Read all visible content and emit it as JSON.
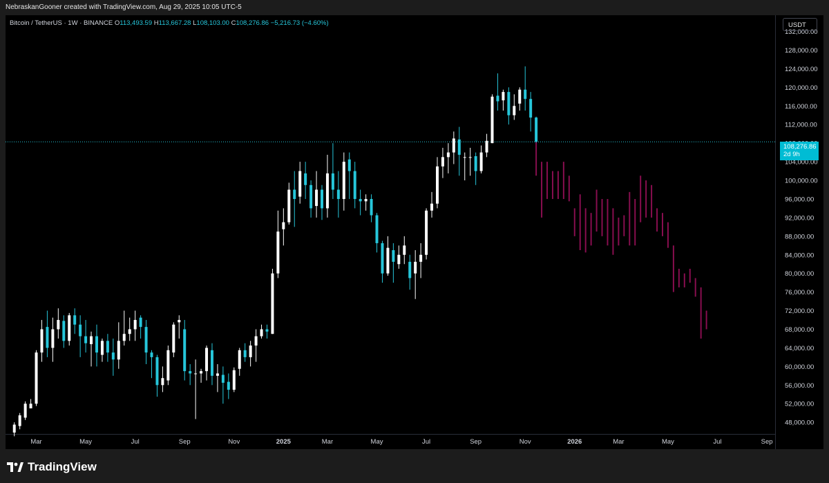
{
  "header": {
    "attribution": "NebraskanGooner created with TradingView.com, Aug 29, 2025 10:05 UTC-5"
  },
  "legend": {
    "symbol": "Bitcoin / TetherUS · 1W · BINANCE",
    "o_label": "O",
    "o": "113,493.59",
    "h_label": "H",
    "h": "113,667.28",
    "l_label": "L",
    "l": "108,103.00",
    "c_label": "C",
    "c": "108,276.86",
    "change": "−5,216.73 (−4.60%)"
  },
  "price_scale": {
    "currency": "USDT",
    "last_price": "108,276.86",
    "countdown": "2d 9h"
  },
  "footer": {
    "brand": "TradingView"
  },
  "colors": {
    "up": "#ffffff",
    "down": "#26c6da",
    "projection": "#880e4f",
    "background": "#000000"
  },
  "chart_data": {
    "type": "candlestick",
    "title": "Bitcoin / TetherUS · 1W · BINANCE",
    "y_ticks": [
      48000,
      52000,
      56000,
      60000,
      64000,
      68000,
      72000,
      76000,
      80000,
      84000,
      88000,
      92000,
      96000,
      100000,
      104000,
      108000,
      112000,
      116000,
      120000,
      124000,
      128000,
      132000
    ],
    "y_tick_labels": [
      "48,000.00",
      "52,000.00",
      "56,000.00",
      "60,000.00",
      "64,000.00",
      "68,000.00",
      "72,000.00",
      "76,000.00",
      "80,000.00",
      "84,000.00",
      "88,000.00",
      "92,000.00",
      "96,000.00",
      "100,000.00",
      "104,000.00",
      "108,000.00",
      "112,000.00",
      "116,000.00",
      "120,000.00",
      "124,000.00",
      "128,000.00",
      "132,000.00"
    ],
    "ylim": [
      45500,
      135500
    ],
    "x_ticks": [
      {
        "label": "Mar",
        "week": 4,
        "bold": false
      },
      {
        "label": "May",
        "week": 13,
        "bold": false
      },
      {
        "label": "Jul",
        "week": 22,
        "bold": false
      },
      {
        "label": "Sep",
        "week": 31,
        "bold": false
      },
      {
        "label": "Nov",
        "week": 40,
        "bold": false
      },
      {
        "label": "2025",
        "week": 49,
        "bold": true
      },
      {
        "label": "Mar",
        "week": 57,
        "bold": false
      },
      {
        "label": "May",
        "week": 66,
        "bold": false
      },
      {
        "label": "Jul",
        "week": 75,
        "bold": false
      },
      {
        "label": "Sep",
        "week": 84,
        "bold": false
      },
      {
        "label": "Nov",
        "week": 93,
        "bold": false
      },
      {
        "label": "2026",
        "week": 102,
        "bold": true
      },
      {
        "label": "Mar",
        "week": 110,
        "bold": false
      },
      {
        "label": "May",
        "week": 119,
        "bold": false
      },
      {
        "label": "Jul",
        "week": 128,
        "bold": false
      },
      {
        "label": "Sep",
        "week": 137,
        "bold": false
      }
    ],
    "x_range_weeks": [
      -1.6,
      138.5
    ],
    "last_price": 108276.86,
    "candles": [
      [
        45800,
        47500,
        45000,
        48000
      ],
      [
        47200,
        49500,
        46500,
        50000
      ],
      [
        49000,
        52000,
        48500,
        52500
      ],
      [
        51000,
        52000,
        51000,
        53000
      ],
      [
        52000,
        63000,
        51500,
        63500
      ],
      [
        63000,
        68000,
        61000,
        70000
      ],
      [
        68500,
        64000,
        62000,
        72000
      ],
      [
        64000,
        68000,
        61000,
        70500
      ],
      [
        68000,
        70000,
        66000,
        72500
      ],
      [
        69800,
        65500,
        64000,
        71000
      ],
      [
        65500,
        71000,
        64500,
        71500
      ],
      [
        71000,
        69000,
        67000,
        72500
      ],
      [
        69000,
        66500,
        62000,
        71000
      ],
      [
        66500,
        65000,
        63000,
        70000
      ],
      [
        64800,
        66500,
        60000,
        67500
      ],
      [
        66500,
        63000,
        60000,
        69000
      ],
      [
        62500,
        65500,
        61000,
        66000
      ],
      [
        65500,
        63000,
        61000,
        67000
      ],
      [
        63000,
        61500,
        58000,
        66000
      ],
      [
        61500,
        65500,
        59500,
        69500
      ],
      [
        65500,
        67000,
        64500,
        72000
      ],
      [
        67000,
        68000,
        65500,
        70500
      ],
      [
        68000,
        70000,
        65500,
        72000
      ],
      [
        70500,
        68500,
        66000,
        71000
      ],
      [
        68500,
        63000,
        60500,
        70000
      ],
      [
        63000,
        62000,
        57500,
        63500
      ],
      [
        62000,
        56000,
        53500,
        62500
      ],
      [
        56000,
        57500,
        54500,
        60000
      ],
      [
        57000,
        63500,
        56000,
        64500
      ],
      [
        63000,
        69000,
        62000,
        69500
      ],
      [
        69500,
        70000,
        66000,
        71000
      ],
      [
        68000,
        59000,
        57000,
        70000
      ],
      [
        59000,
        58500,
        56000,
        60500
      ],
      [
        58500,
        58500,
        48700,
        61500
      ],
      [
        58500,
        59000,
        56500,
        59500
      ],
      [
        59000,
        64000,
        57000,
        64500
      ],
      [
        63500,
        58000,
        56000,
        65000
      ],
      [
        58000,
        58500,
        54500,
        60500
      ],
      [
        58200,
        56500,
        52000,
        60000
      ],
      [
        56700,
        55000,
        53000,
        58500
      ],
      [
        55000,
        59200,
        54500,
        59800
      ],
      [
        59500,
        63500,
        58000,
        64000
      ],
      [
        63500,
        62000,
        61000,
        65000
      ],
      [
        62000,
        64500,
        60000,
        65500
      ],
      [
        64500,
        66500,
        61000,
        68000
      ],
      [
        66500,
        68000,
        66000,
        69000
      ],
      [
        68000,
        67500,
        66000,
        69000
      ],
      [
        67000,
        80000,
        67000,
        81000
      ],
      [
        80000,
        89000,
        79000,
        93500
      ],
      [
        89500,
        91000,
        86000,
        94000
      ],
      [
        91000,
        98000,
        90500,
        99500
      ],
      [
        98000,
        96000,
        90000,
        102000
      ],
      [
        96500,
        102000,
        95000,
        104000
      ],
      [
        101500,
        99000,
        96000,
        104000
      ],
      [
        99000,
        94000,
        92000,
        100000
      ],
      [
        94500,
        98000,
        92000,
        102000
      ],
      [
        98000,
        94000,
        91500,
        99000
      ],
      [
        94000,
        101500,
        92000,
        105500
      ],
      [
        101500,
        98000,
        96000,
        108000
      ],
      [
        98000,
        96000,
        92000,
        102000
      ],
      [
        96000,
        104000,
        93500,
        106000
      ],
      [
        104500,
        102000,
        96000,
        106000
      ],
      [
        102000,
        96000,
        94000,
        104000
      ],
      [
        96000,
        95500,
        92500,
        98000
      ],
      [
        95500,
        96000,
        93500,
        97000
      ],
      [
        96000,
        92500,
        91000,
        97000
      ],
      [
        92500,
        86500,
        84500,
        93000
      ],
      [
        86500,
        80000,
        78000,
        87000
      ],
      [
        80000,
        85500,
        79500,
        88000
      ],
      [
        85000,
        82500,
        78000,
        86500
      ],
      [
        82000,
        84000,
        81000,
        86000
      ],
      [
        84000,
        86000,
        82000,
        88000
      ],
      [
        82500,
        79000,
        76500,
        84000
      ],
      [
        80000,
        82500,
        74500,
        85000
      ],
      [
        82500,
        84000,
        79000,
        86500
      ],
      [
        84000,
        93500,
        83000,
        94000
      ],
      [
        93500,
        95000,
        92000,
        97500
      ],
      [
        95000,
        103000,
        94000,
        105000
      ],
      [
        103000,
        105000,
        100500,
        107000
      ],
      [
        105000,
        106000,
        101500,
        108000
      ],
      [
        106000,
        109000,
        103500,
        110500
      ],
      [
        108800,
        105500,
        101000,
        111500
      ],
      [
        105000,
        105000,
        100000,
        106000
      ],
      [
        105000,
        105000,
        101000,
        107000
      ],
      [
        105200,
        102000,
        99000,
        106000
      ],
      [
        102000,
        106000,
        101500,
        107500
      ],
      [
        106000,
        108500,
        105000,
        110000
      ],
      [
        108000,
        118000,
        108000,
        118500
      ],
      [
        118200,
        117000,
        115000,
        123000
      ],
      [
        117200,
        119000,
        115000,
        119500
      ],
      [
        119000,
        114000,
        112000,
        120000
      ],
      [
        114000,
        116000,
        113000,
        118500
      ],
      [
        116500,
        119500,
        115000,
        120000
      ],
      [
        119500,
        117500,
        115000,
        124500
      ],
      [
        117500,
        113500,
        110500,
        119000
      ],
      [
        113500,
        108300,
        108100,
        113700
      ]
    ],
    "projection": [
      [
        95,
        113500,
        101000
      ],
      [
        96,
        104000,
        92000
      ],
      [
        97,
        104000,
        96000
      ],
      [
        98,
        102000,
        96000
      ],
      [
        99,
        102000,
        96000
      ],
      [
        100,
        104000,
        96000
      ],
      [
        101,
        101000,
        95500
      ],
      [
        102,
        94000,
        88000
      ],
      [
        103,
        97000,
        85000
      ],
      [
        104,
        94000,
        84500
      ],
      [
        105,
        93000,
        86000
      ],
      [
        106,
        98000,
        89000
      ],
      [
        107,
        96000,
        88000
      ],
      [
        108,
        96000,
        86000
      ],
      [
        109,
        94000,
        84000
      ],
      [
        110,
        92000,
        86000
      ],
      [
        111,
        92500,
        88000
      ],
      [
        112,
        97500,
        86000
      ],
      [
        113,
        96000,
        86000
      ],
      [
        114,
        101000,
        91000
      ],
      [
        115,
        100000,
        92000
      ],
      [
        116,
        99000,
        92000
      ],
      [
        117,
        94000,
        89000
      ],
      [
        118,
        93000,
        88000
      ],
      [
        119,
        91000,
        85500
      ],
      [
        120,
        86000,
        76000
      ],
      [
        121,
        81000,
        77000
      ],
      [
        122,
        80000,
        77000
      ],
      [
        123,
        81000,
        78000
      ],
      [
        124,
        79000,
        75000
      ],
      [
        125,
        77000,
        66000
      ],
      [
        126,
        72000,
        68000
      ]
    ]
  }
}
